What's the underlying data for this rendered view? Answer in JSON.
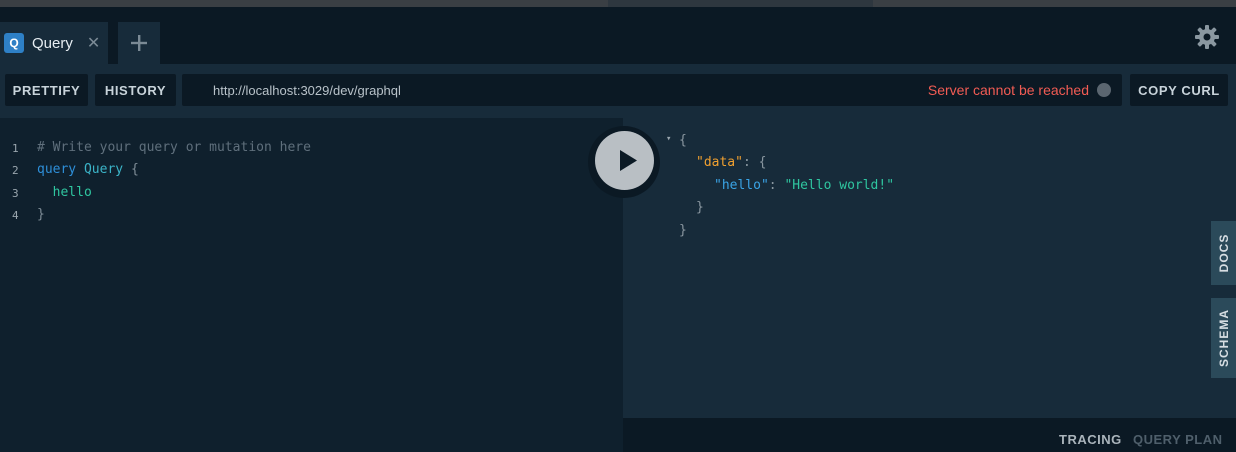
{
  "tabs": [
    {
      "badge": "Q",
      "label": "Query"
    }
  ],
  "tab_close_glyph": "✕",
  "toolbar": {
    "prettify_label": "PRETTIFY",
    "history_label": "HISTORY",
    "endpoint_url": "http://localhost:3029/dev/graphql",
    "server_status": "Server cannot be reached",
    "copy_curl_label": "COPY CURL"
  },
  "editor": {
    "line_numbers": [
      "1",
      "2",
      "3",
      "4"
    ],
    "line1_comment": "# Write your query or mutation here",
    "line2_keyword": "query",
    "line2_name": "Query",
    "line2_brace": "{",
    "line3_field": "hello",
    "line4_brace": "}"
  },
  "result": {
    "fold_glyph": "▾",
    "open_brace": "{",
    "data_key": "\"data\"",
    "colon": ":",
    "inner_open": "{",
    "hello_key": "\"hello\"",
    "hello_value": "\"Hello world!\"",
    "inner_close": "}",
    "close_brace": "}"
  },
  "side_tabs": {
    "docs_label": "DOCS",
    "schema_label": "SCHEMA"
  },
  "footer": {
    "tracing_label": "TRACING",
    "query_plan_label": "QUERY PLAN"
  },
  "colors": {
    "accent": "#2e80c6",
    "error": "#f25c54",
    "background": "#0f202d",
    "panel": "#172b3a"
  }
}
